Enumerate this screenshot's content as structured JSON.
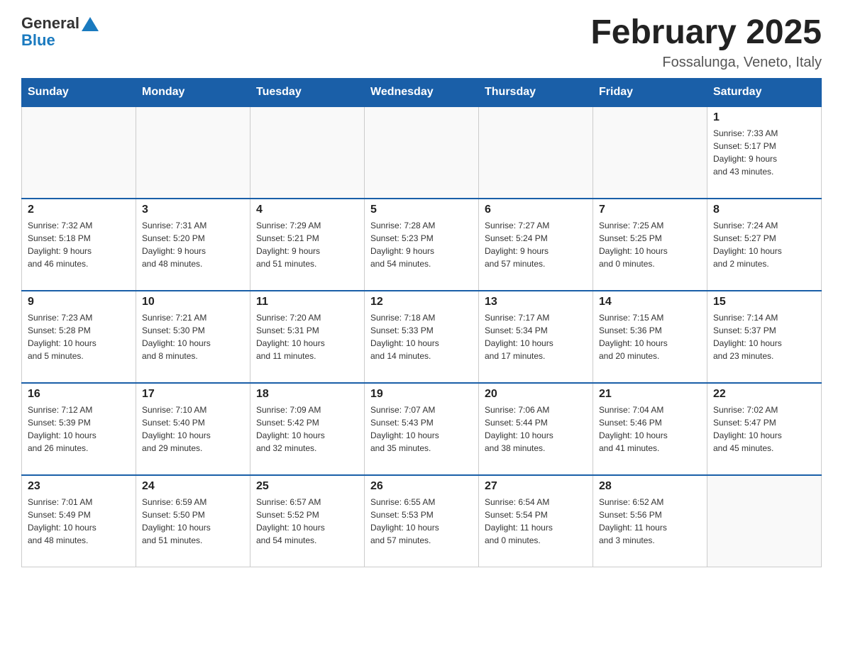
{
  "header": {
    "logo": {
      "general": "General",
      "blue": "Blue",
      "triangle_color": "#1a7abf"
    },
    "title": "February 2025",
    "subtitle": "Fossalunga, Veneto, Italy"
  },
  "weekdays": [
    "Sunday",
    "Monday",
    "Tuesday",
    "Wednesday",
    "Thursday",
    "Friday",
    "Saturday"
  ],
  "weeks": [
    [
      {
        "day": "",
        "info": ""
      },
      {
        "day": "",
        "info": ""
      },
      {
        "day": "",
        "info": ""
      },
      {
        "day": "",
        "info": ""
      },
      {
        "day": "",
        "info": ""
      },
      {
        "day": "",
        "info": ""
      },
      {
        "day": "1",
        "info": "Sunrise: 7:33 AM\nSunset: 5:17 PM\nDaylight: 9 hours\nand 43 minutes."
      }
    ],
    [
      {
        "day": "2",
        "info": "Sunrise: 7:32 AM\nSunset: 5:18 PM\nDaylight: 9 hours\nand 46 minutes."
      },
      {
        "day": "3",
        "info": "Sunrise: 7:31 AM\nSunset: 5:20 PM\nDaylight: 9 hours\nand 48 minutes."
      },
      {
        "day": "4",
        "info": "Sunrise: 7:29 AM\nSunset: 5:21 PM\nDaylight: 9 hours\nand 51 minutes."
      },
      {
        "day": "5",
        "info": "Sunrise: 7:28 AM\nSunset: 5:23 PM\nDaylight: 9 hours\nand 54 minutes."
      },
      {
        "day": "6",
        "info": "Sunrise: 7:27 AM\nSunset: 5:24 PM\nDaylight: 9 hours\nand 57 minutes."
      },
      {
        "day": "7",
        "info": "Sunrise: 7:25 AM\nSunset: 5:25 PM\nDaylight: 10 hours\nand 0 minutes."
      },
      {
        "day": "8",
        "info": "Sunrise: 7:24 AM\nSunset: 5:27 PM\nDaylight: 10 hours\nand 2 minutes."
      }
    ],
    [
      {
        "day": "9",
        "info": "Sunrise: 7:23 AM\nSunset: 5:28 PM\nDaylight: 10 hours\nand 5 minutes."
      },
      {
        "day": "10",
        "info": "Sunrise: 7:21 AM\nSunset: 5:30 PM\nDaylight: 10 hours\nand 8 minutes."
      },
      {
        "day": "11",
        "info": "Sunrise: 7:20 AM\nSunset: 5:31 PM\nDaylight: 10 hours\nand 11 minutes."
      },
      {
        "day": "12",
        "info": "Sunrise: 7:18 AM\nSunset: 5:33 PM\nDaylight: 10 hours\nand 14 minutes."
      },
      {
        "day": "13",
        "info": "Sunrise: 7:17 AM\nSunset: 5:34 PM\nDaylight: 10 hours\nand 17 minutes."
      },
      {
        "day": "14",
        "info": "Sunrise: 7:15 AM\nSunset: 5:36 PM\nDaylight: 10 hours\nand 20 minutes."
      },
      {
        "day": "15",
        "info": "Sunrise: 7:14 AM\nSunset: 5:37 PM\nDaylight: 10 hours\nand 23 minutes."
      }
    ],
    [
      {
        "day": "16",
        "info": "Sunrise: 7:12 AM\nSunset: 5:39 PM\nDaylight: 10 hours\nand 26 minutes."
      },
      {
        "day": "17",
        "info": "Sunrise: 7:10 AM\nSunset: 5:40 PM\nDaylight: 10 hours\nand 29 minutes."
      },
      {
        "day": "18",
        "info": "Sunrise: 7:09 AM\nSunset: 5:42 PM\nDaylight: 10 hours\nand 32 minutes."
      },
      {
        "day": "19",
        "info": "Sunrise: 7:07 AM\nSunset: 5:43 PM\nDaylight: 10 hours\nand 35 minutes."
      },
      {
        "day": "20",
        "info": "Sunrise: 7:06 AM\nSunset: 5:44 PM\nDaylight: 10 hours\nand 38 minutes."
      },
      {
        "day": "21",
        "info": "Sunrise: 7:04 AM\nSunset: 5:46 PM\nDaylight: 10 hours\nand 41 minutes."
      },
      {
        "day": "22",
        "info": "Sunrise: 7:02 AM\nSunset: 5:47 PM\nDaylight: 10 hours\nand 45 minutes."
      }
    ],
    [
      {
        "day": "23",
        "info": "Sunrise: 7:01 AM\nSunset: 5:49 PM\nDaylight: 10 hours\nand 48 minutes."
      },
      {
        "day": "24",
        "info": "Sunrise: 6:59 AM\nSunset: 5:50 PM\nDaylight: 10 hours\nand 51 minutes."
      },
      {
        "day": "25",
        "info": "Sunrise: 6:57 AM\nSunset: 5:52 PM\nDaylight: 10 hours\nand 54 minutes."
      },
      {
        "day": "26",
        "info": "Sunrise: 6:55 AM\nSunset: 5:53 PM\nDaylight: 10 hours\nand 57 minutes."
      },
      {
        "day": "27",
        "info": "Sunrise: 6:54 AM\nSunset: 5:54 PM\nDaylight: 11 hours\nand 0 minutes."
      },
      {
        "day": "28",
        "info": "Sunrise: 6:52 AM\nSunset: 5:56 PM\nDaylight: 11 hours\nand 3 minutes."
      },
      {
        "day": "",
        "info": ""
      }
    ]
  ]
}
